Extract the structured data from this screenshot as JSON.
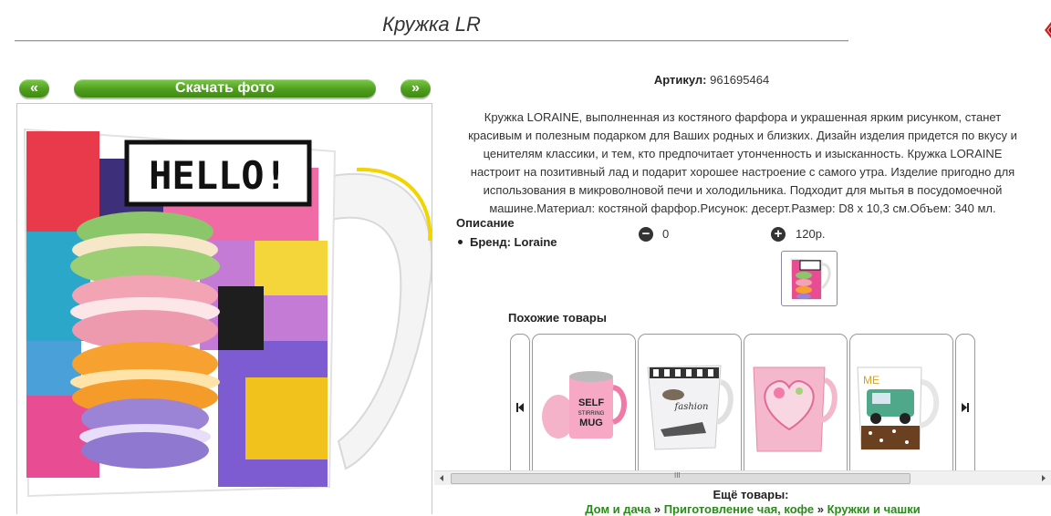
{
  "page": {
    "title": "Кружка LR"
  },
  "gallery": {
    "prev_label": "«",
    "download_label": "Скачать фото",
    "next_label": "»",
    "photo_text": "HELLO!"
  },
  "product": {
    "article_label": "Артикул:",
    "article_value": "961695464",
    "description_lines": [
      "Кружка LORAINE, выполненная из костяного фарфора и украшенная ярким рисунком, станет",
      "красивым и полезным подарком для Ваших родных и близких. Дизайн изделия придется по вкусу и",
      "ценителям классики, и тем, кто предпочитает утонченность и изысканность. Кружка LORAINE",
      "настроит на позитивный лад и подарит хорошее настроение с самого утра. Изделие пригодно для",
      "использования в микроволновой печи и холодильника. Подходит для мытья в посудомоечной",
      "машине.Материал: костяной фарфор.Рисунок: десерт.Размер: D8 x 10,3 см.Объем: 340 мл."
    ],
    "description_heading": "Описание",
    "brand_label": "Бренд: Loraine",
    "minus_symbol": "−",
    "minus_value": "0",
    "plus_symbol": "+",
    "plus_value": "120р."
  },
  "similar": {
    "heading": "Похожие товары",
    "items": [
      {
        "name": "self-stirring-mug",
        "text": [
          "SELF",
          "STIRRING",
          "MUG"
        ]
      },
      {
        "name": "fashion-mug",
        "text": [
          "fashion"
        ]
      },
      {
        "name": "heart-mug",
        "text": []
      },
      {
        "name": "car-mug",
        "text": [
          "ME"
        ]
      }
    ],
    "scroll_center_label": "III"
  },
  "footer": {
    "more_label": "Ещё товары:",
    "crumbs": [
      "Дом и дача",
      "Приготовление чая, кофе",
      "Кружки и чашки"
    ],
    "crumb_sep": "»"
  },
  "colors": {
    "accent_green": "#4f9e1e",
    "link_green": "#2a8a1a",
    "close_red": "#d22222"
  }
}
